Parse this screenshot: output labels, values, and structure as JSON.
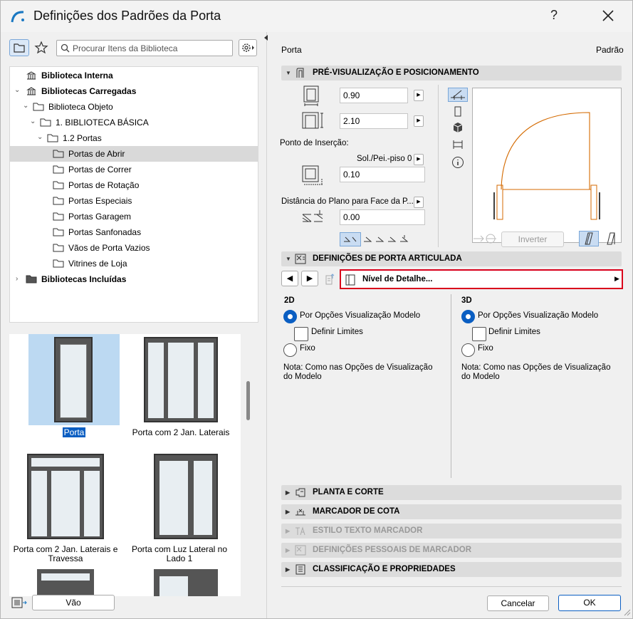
{
  "window": {
    "title": "Definições dos Padrões da Porta",
    "help": "?"
  },
  "search": {
    "placeholder": "Procurar Itens da Biblioteca"
  },
  "tree": [
    {
      "label": "Biblioteca Interna"
    },
    {
      "label": "Bibliotecas Carregadas"
    },
    {
      "label": "Biblioteca Objeto"
    },
    {
      "label": "1. BIBLIOTECA BÁSICA"
    },
    {
      "label": "1.2 Portas"
    },
    {
      "label": "Portas de Abrir"
    },
    {
      "label": "Portas de Correr"
    },
    {
      "label": "Portas de Rotação"
    },
    {
      "label": "Portas Especiais"
    },
    {
      "label": "Portas Garagem"
    },
    {
      "label": "Portas Sanfonadas"
    },
    {
      "label": "Vãos de Porta Vazios"
    },
    {
      "label": "Vitrines de Loja"
    },
    {
      "label": "Bibliotecas Incluídas"
    }
  ],
  "thumbs": [
    {
      "caption": "Porta"
    },
    {
      "caption": "Porta com 2 Jan. Laterais"
    },
    {
      "caption": "Porta com 2 Jan. Laterais e Travessa"
    },
    {
      "caption": "Porta com Luz Lateral no Lado 1"
    }
  ],
  "footer_left": {
    "vao": "Vão"
  },
  "right": {
    "object_name": "Porta",
    "default_label": "Padrão",
    "preview_header": "PRÉ-VISUALIZAÇÃO E POSICIONAMENTO",
    "width": "0.90",
    "height": "2.10",
    "insertion_label": "Ponto de Inserção:",
    "sill_label": "Sol./Pei.-piso 0",
    "sill_value": "0.10",
    "plane_label": "Distância do Plano para Face da P...",
    "plane_value": "0.00",
    "invert": "Inverter",
    "door_header": "DEFINIÇÕES DE PORTA ARTICULADA",
    "detail_level": "Nível de Detalhe...",
    "col2d": {
      "title": "2D",
      "opt1": "Por Opções Visualização Modelo",
      "limits": "Definir Limites",
      "opt2": "Fixo",
      "note": "Nota: Como nas Opções de Visualização do Modelo"
    },
    "col3d": {
      "title": "3D",
      "opt1": "Por Opções Visualização Modelo",
      "limits": "Definir Limites",
      "opt2": "Fixo",
      "note": "Nota: Como nas Opções de Visualização do Modelo"
    },
    "sections": [
      {
        "label": "PLANTA E CORTE"
      },
      {
        "label": "MARCADOR DE COTA"
      },
      {
        "label": "ESTILO TEXTO MARCADOR"
      },
      {
        "label": "DEFINIÇÕES PESSOAIS DE MARCADOR"
      },
      {
        "label": "CLASSIFICAÇÃO E PROPRIEDADES"
      }
    ],
    "cancel": "Cancelar",
    "ok": "OK"
  },
  "colors": {
    "accent": "#0a5ec2",
    "highlight_border": "#d9001b",
    "door_line": "#d46a00",
    "thumb_selected": "#bcd9f2"
  }
}
